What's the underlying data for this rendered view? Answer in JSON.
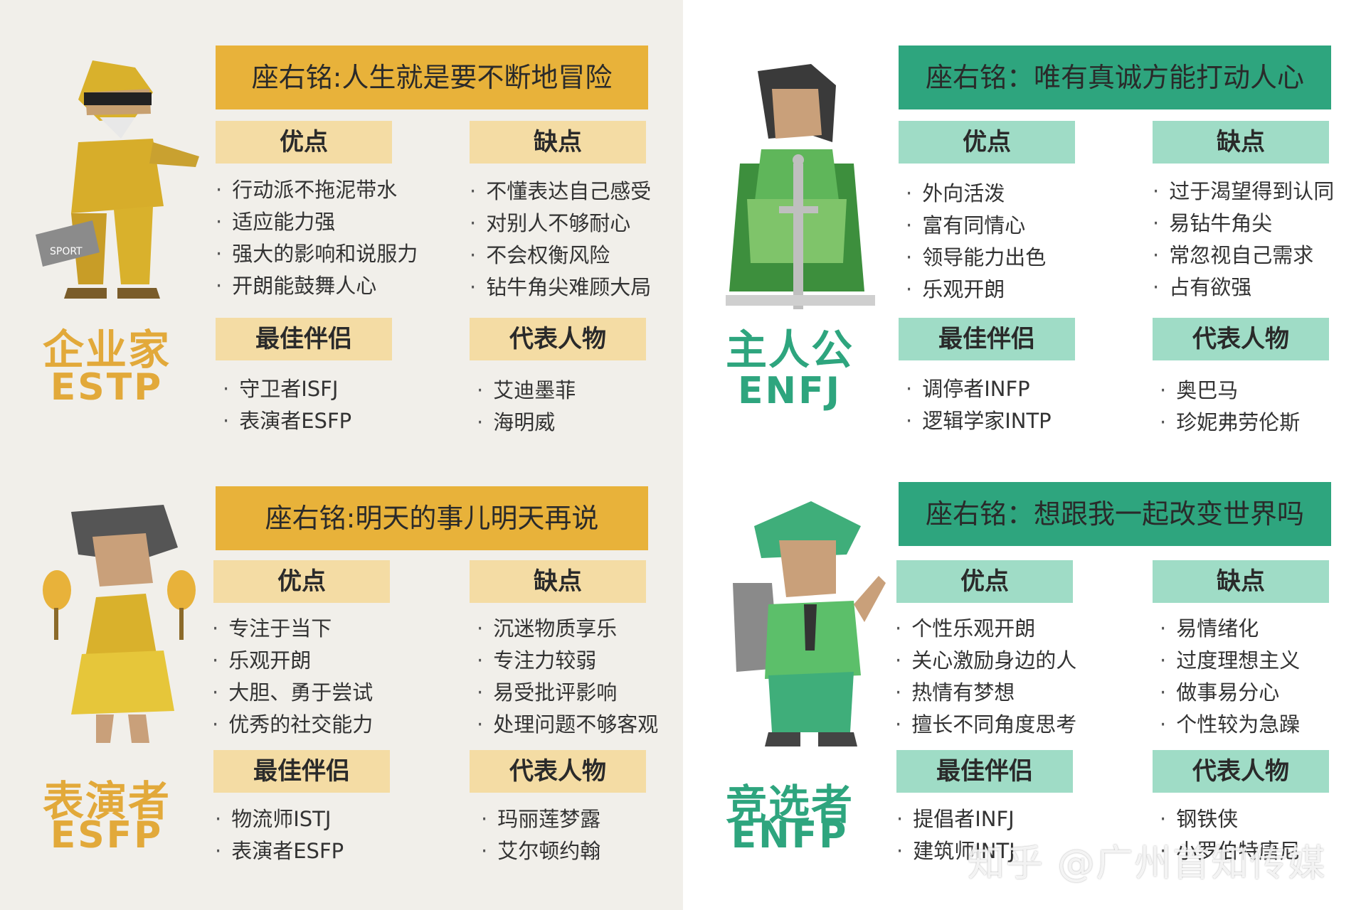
{
  "colors": {
    "gold_dark": "#E8B23A",
    "gold_light": "#F4DCA4",
    "gold_text": "#E2A93A",
    "green_dark": "#2EA57E",
    "green_light": "#9FDCC6",
    "green_text": "#2EA57E"
  },
  "cards": [
    {
      "id": "estp",
      "name": "企业家",
      "code": "ESTP",
      "motto": "座右铭:人生就是要不断地冒险",
      "pros_label": "优点",
      "cons_label": "缺点",
      "partner_label": "最佳伴侣",
      "people_label": "代表人物",
      "pros": [
        "行动派不拖泥带水",
        "适应能力强",
        "强大的影响和说服力",
        "开朗能鼓舞人心"
      ],
      "cons": [
        "不懂表达自己感受",
        "对别人不够耐心",
        "不会权衡风险",
        "钻牛角尖难顾大局"
      ],
      "partners": [
        "守卫者ISFJ",
        "表演者ESFP"
      ],
      "people": [
        "艾迪墨菲",
        "海明威"
      ],
      "bag_text": "SPORT"
    },
    {
      "id": "enfj",
      "name": "主人公",
      "code": "ENFJ",
      "motto": "座右铭：唯有真诚方能打动人心",
      "pros_label": "优点",
      "cons_label": "缺点",
      "partner_label": "最佳伴侣",
      "people_label": "代表人物",
      "pros": [
        "外向活泼",
        "富有同情心",
        "领导能力出色",
        "乐观开朗"
      ],
      "cons": [
        "过于渴望得到认同",
        "易钻牛角尖",
        "常忽视自己需求",
        "占有欲强"
      ],
      "partners": [
        "调停者INFP",
        "逻辑学家INTP"
      ],
      "people": [
        "奥巴马",
        "珍妮弗劳伦斯"
      ]
    },
    {
      "id": "esfp",
      "name": "表演者",
      "code": "ESFP",
      "motto": "座右铭:明天的事儿明天再说",
      "pros_label": "优点",
      "cons_label": "缺点",
      "partner_label": "最佳伴侣",
      "people_label": "代表人物",
      "pros": [
        "专注于当下",
        "乐观开朗",
        "大胆、勇于尝试",
        "优秀的社交能力"
      ],
      "cons": [
        "沉迷物质享乐",
        "专注力较弱",
        "易受批评影响",
        "处理问题不够客观"
      ],
      "partners": [
        "物流师ISTJ",
        "表演者ESFP"
      ],
      "people": [
        "玛丽莲梦露",
        "艾尔顿约翰"
      ]
    },
    {
      "id": "enfp",
      "name": "竞选者",
      "code": "ENFP",
      "motto": "座右铭：想跟我一起改变世界吗",
      "pros_label": "优点",
      "cons_label": "缺点",
      "partner_label": "最佳伴侣",
      "people_label": "代表人物",
      "pros": [
        "个性乐观开朗",
        "关心激励身边的人",
        "热情有梦想",
        "擅长不同角度思考"
      ],
      "cons": [
        "易情绪化",
        "过度理想主义",
        "做事易分心",
        "个性较为急躁"
      ],
      "partners": [
        "提倡者INFJ",
        "建筑师INTJ"
      ],
      "people": [
        "钢铁侠",
        "小罗伯特唐尼"
      ]
    }
  ],
  "watermark": "知乎 @广州首知传媒"
}
